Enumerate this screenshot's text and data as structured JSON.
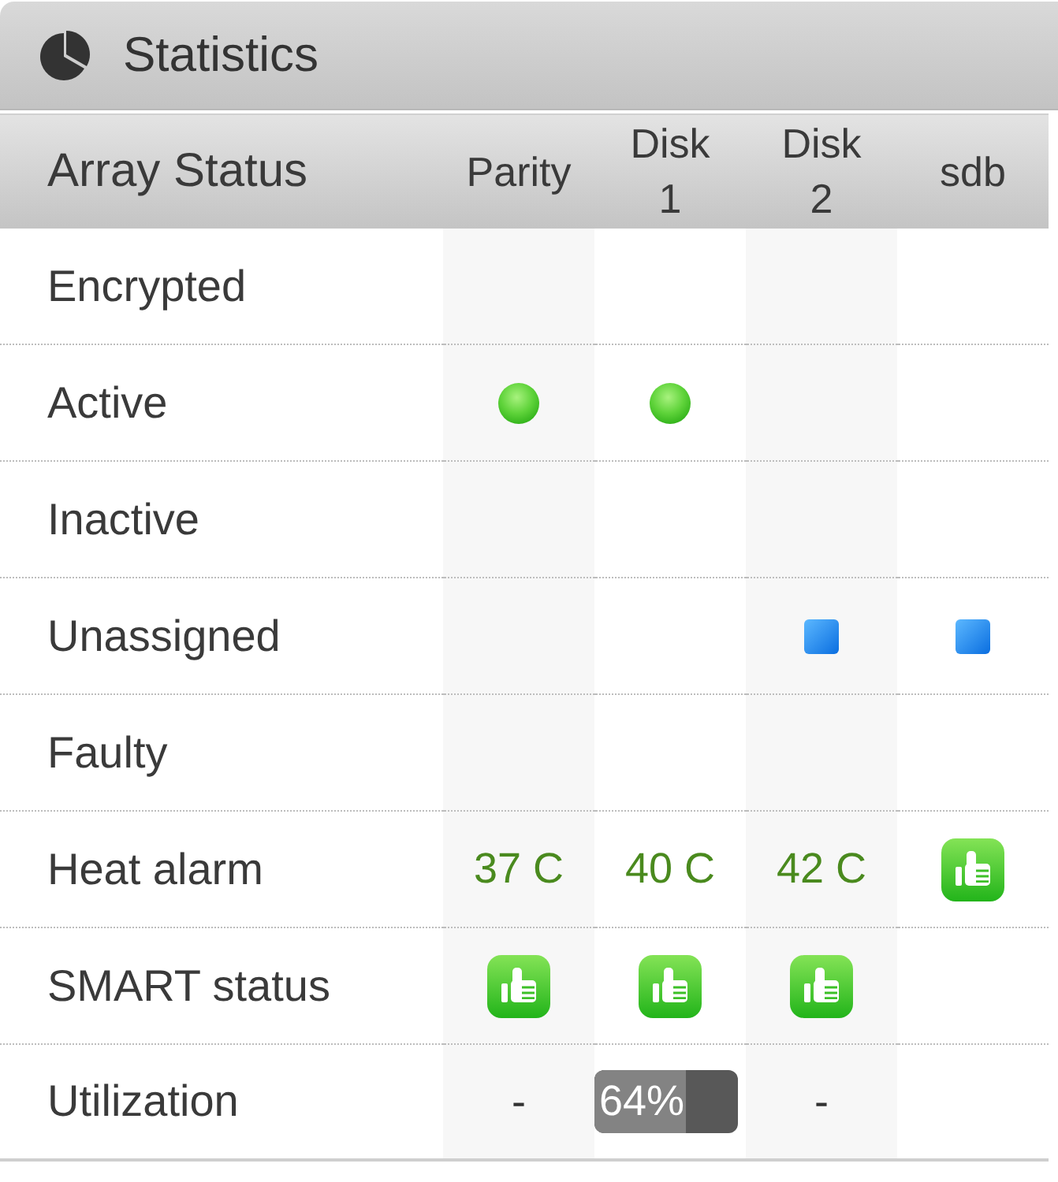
{
  "panel": {
    "title": "Statistics"
  },
  "table": {
    "title": "Array Status",
    "columns": [
      "Parity",
      "Disk 1",
      "Disk 2",
      "sdb"
    ],
    "rows": [
      {
        "label": "Encrypted",
        "cells": [
          null,
          null,
          null,
          null
        ]
      },
      {
        "label": "Active",
        "cells": [
          {
            "kind": "dot"
          },
          {
            "kind": "dot"
          },
          null,
          null
        ]
      },
      {
        "label": "Inactive",
        "cells": [
          null,
          null,
          null,
          null
        ]
      },
      {
        "label": "Unassigned",
        "cells": [
          null,
          null,
          {
            "kind": "square"
          },
          {
            "kind": "square"
          }
        ]
      },
      {
        "label": "Faulty",
        "cells": [
          null,
          null,
          null,
          null
        ]
      },
      {
        "label": "Heat alarm",
        "cells": [
          {
            "kind": "temp",
            "text": "37 C"
          },
          {
            "kind": "temp",
            "text": "40 C"
          },
          {
            "kind": "temp",
            "text": "42 C"
          },
          {
            "kind": "thumb"
          }
        ]
      },
      {
        "label": "SMART status",
        "cells": [
          {
            "kind": "thumb"
          },
          {
            "kind": "thumb"
          },
          {
            "kind": "thumb"
          },
          null
        ]
      },
      {
        "label": "Utilization",
        "cells": [
          {
            "kind": "text",
            "text": "-"
          },
          {
            "kind": "bar",
            "level": 0.64,
            "text": "64%"
          },
          {
            "kind": "text",
            "text": "-"
          },
          null
        ]
      }
    ]
  }
}
